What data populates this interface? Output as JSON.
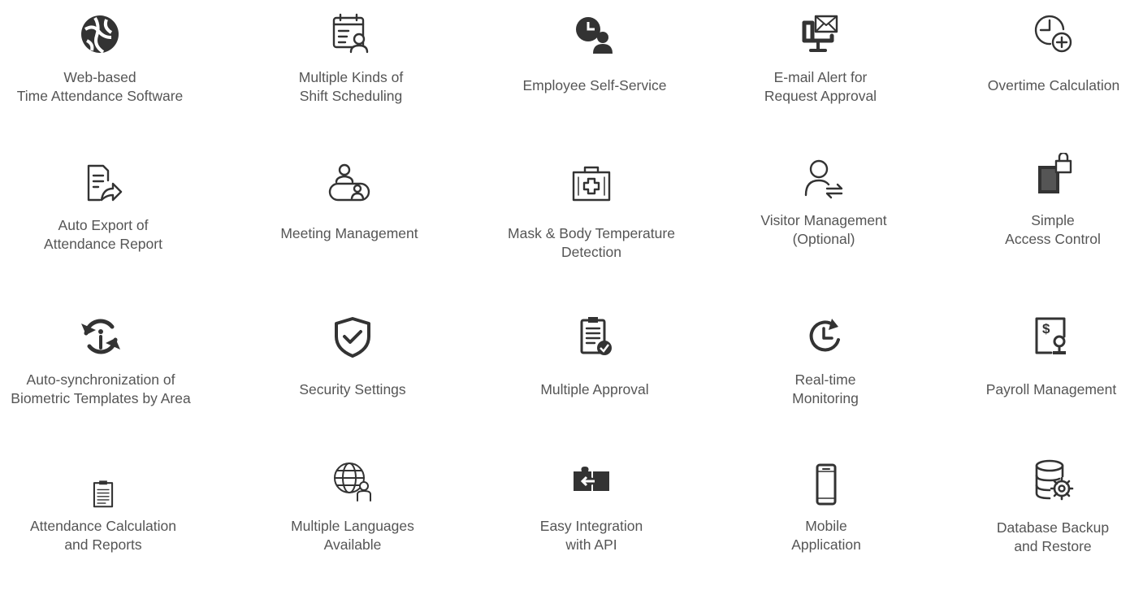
{
  "features": [
    {
      "icon": "globe-icon",
      "lines": [
        "Web-based",
        "Time Attendance Software"
      ]
    },
    {
      "icon": "shift-calendar-icon",
      "lines": [
        "Multiple Kinds of",
        "Shift Scheduling"
      ]
    },
    {
      "icon": "employee-clock-icon",
      "lines": [
        "Employee Self-Service"
      ]
    },
    {
      "icon": "email-alert-monitor-icon",
      "lines": [
        "E-mail Alert for",
        "Request Approval"
      ]
    },
    {
      "icon": "clock-plus-icon",
      "lines": [
        "Overtime Calculation"
      ]
    },
    {
      "icon": "export-report-icon",
      "lines": [
        "Auto Export of",
        "Attendance Report"
      ]
    },
    {
      "icon": "meeting-icon",
      "lines": [
        "Meeting Management"
      ]
    },
    {
      "icon": "medical-kit-icon",
      "lines": [
        "Mask & Body Temperature",
        "Detection"
      ]
    },
    {
      "icon": "visitor-swap-icon",
      "lines": [
        "Visitor Management",
        "(Optional)"
      ]
    },
    {
      "icon": "door-lock-icon",
      "lines": [
        "Simple",
        "Access Control"
      ]
    },
    {
      "icon": "sync-icon",
      "lines": [
        "Auto-synchronization of",
        "Biometric Templates by Area"
      ]
    },
    {
      "icon": "shield-check-icon",
      "lines": [
        "Security Settings"
      ]
    },
    {
      "icon": "clipboard-check-icon",
      "lines": [
        "Multiple Approval"
      ]
    },
    {
      "icon": "clock-refresh-icon",
      "lines": [
        "Real-time",
        "Monitoring"
      ]
    },
    {
      "icon": "payroll-icon",
      "lines": [
        "Payroll Management"
      ]
    },
    {
      "icon": "clipboard-list-icon",
      "lines": [
        "Attendance Calculation",
        "and Reports"
      ]
    },
    {
      "icon": "globe-person-icon",
      "lines": [
        "Multiple Languages",
        "Available"
      ]
    },
    {
      "icon": "puzzle-icon",
      "lines": [
        "Easy Integration",
        "with API"
      ]
    },
    {
      "icon": "mobile-phone-icon",
      "lines": [
        "Mobile",
        "Application"
      ]
    },
    {
      "icon": "database-gear-icon",
      "lines": [
        "Database Backup",
        "and Restore"
      ]
    }
  ]
}
